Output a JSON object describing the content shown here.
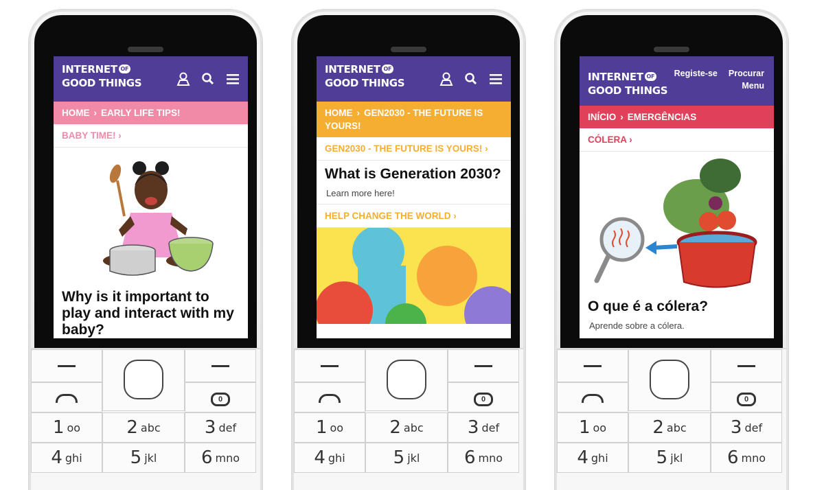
{
  "logo": {
    "line1": "INTERNET",
    "of": "OF",
    "line2": "GOOD THINGS"
  },
  "phones": [
    {
      "header_type": "icons",
      "header_icons": [
        "user-icon",
        "search-icon",
        "menu-icon"
      ],
      "breadcrumb": {
        "color": "#f08aa7",
        "home": "HOME",
        "current": "EARLY LIFE TIPS!"
      },
      "sublink": {
        "label": "BABY TIME!",
        "color": "#f08aa7"
      },
      "article": {
        "title": "Why is it important to play and interact with my baby?"
      }
    },
    {
      "header_type": "icons",
      "header_icons": [
        "user-icon",
        "search-icon",
        "menu-icon"
      ],
      "breadcrumb": {
        "color": "#f5ae31",
        "home": "HOME",
        "current": "GEN2030 - THE FUTURE IS YOURS!"
      },
      "sublink": {
        "label": "GEN2030 - THE FUTURE IS YOURS!",
        "color": "#f5ae31"
      },
      "article": {
        "title": "What is Generation 2030?",
        "desc": "Learn more here!"
      },
      "sublink2": {
        "label": "HELP CHANGE THE WORLD",
        "color": "#f5ae31"
      }
    },
    {
      "header_type": "text",
      "nav": {
        "register": "Registe-se",
        "search": "Procurar",
        "menu": "Menu"
      },
      "breadcrumb": {
        "color": "#e0405a",
        "home": "INÍCIO",
        "current": "EMERGÊNCIAS"
      },
      "sublink": {
        "label": "CÓLERA",
        "color": "#e0405a"
      },
      "article": {
        "title": "O que é a cólera?",
        "desc": "Aprende sobre a cólera."
      }
    }
  ],
  "keypad": {
    "keys": [
      {
        "num": "1",
        "letters": "oo"
      },
      {
        "num": "2",
        "letters": "abc"
      },
      {
        "num": "3",
        "letters": "def"
      },
      {
        "num": "4",
        "letters": "ghi"
      },
      {
        "num": "5",
        "letters": "jkl"
      },
      {
        "num": "6",
        "letters": "mno"
      }
    ]
  },
  "colors": {
    "header_purple": "#4f3d97"
  }
}
